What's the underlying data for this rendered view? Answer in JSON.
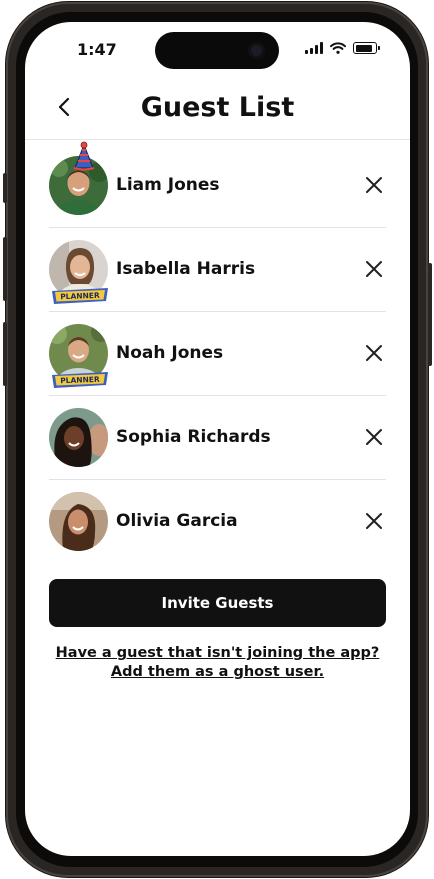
{
  "status_bar": {
    "time": "1:47"
  },
  "header": {
    "title": "Guest List"
  },
  "guests": [
    {
      "name": "Liam Jones",
      "badge": "",
      "host": true
    },
    {
      "name": "Isabella Harris",
      "badge": "PLANNER",
      "host": false
    },
    {
      "name": "Noah Jones",
      "badge": "PLANNER",
      "host": false
    },
    {
      "name": "Sophia Richards",
      "badge": "",
      "host": false
    },
    {
      "name": "Olivia Garcia",
      "badge": "",
      "host": false
    }
  ],
  "actions": {
    "invite_label": "Invite Guests",
    "ghost_link": "Have a guest that isn't joining the app? Add them as a ghost user."
  },
  "colors": {
    "primary": "#111111",
    "badge_bg": "#f3c93d",
    "badge_border": "#3f5fbf"
  },
  "icons": [
    "back-chevron-icon",
    "remove-x-icon",
    "party-hat-icon",
    "signal-icon",
    "wifi-icon",
    "battery-icon"
  ]
}
